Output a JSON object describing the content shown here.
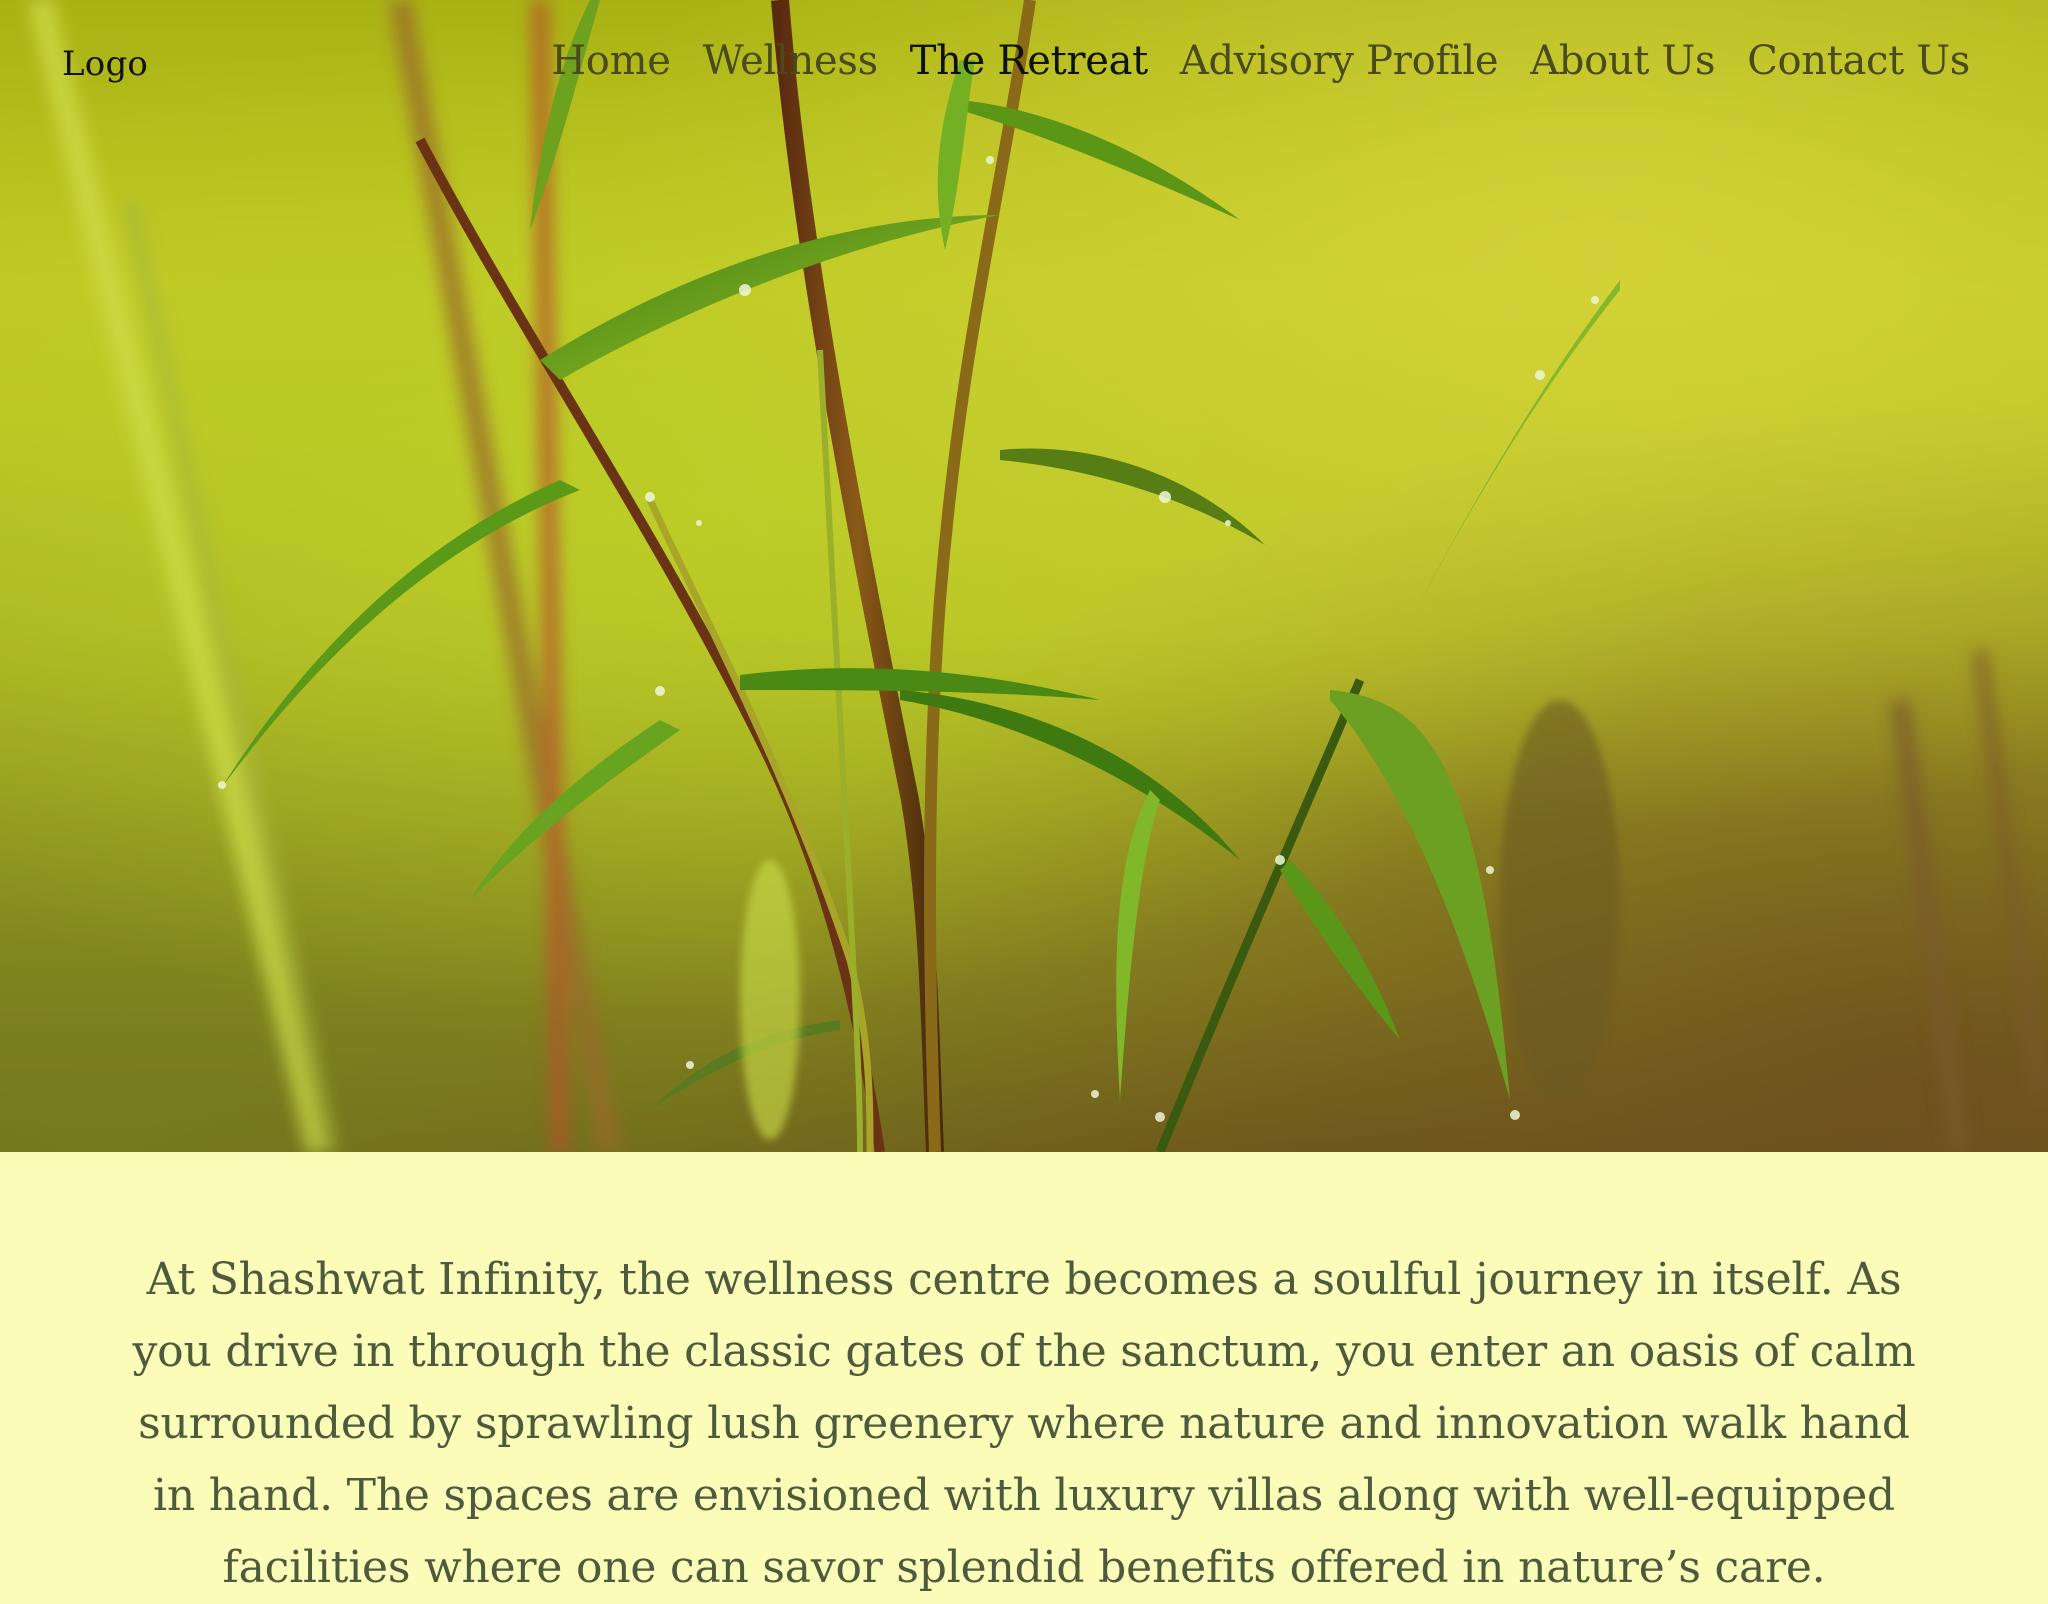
{
  "header": {
    "logo": "Logo",
    "nav": [
      {
        "label": "Home",
        "active": false
      },
      {
        "label": "Wellness",
        "active": false
      },
      {
        "label": "The Retreat",
        "active": true
      },
      {
        "label": "Advisory Profile",
        "active": false
      },
      {
        "label": "About Us",
        "active": false
      },
      {
        "label": "Contact Us",
        "active": false
      }
    ]
  },
  "hero": {
    "image_subject": "bamboo-shoots-with-dew-drops"
  },
  "intro": {
    "text": "At Shashwat Infinity, the wellness centre becomes a soulful journey in itself. As you drive in through the classic gates of the sanctum, you enter an oasis of calm surrounded by sprawling lush greenery where nature and innovation walk hand in hand. The spaces are envisioned with luxury villas along with well-equipped facilities where one can savor splendid benefits offered in nature’s care."
  },
  "colors": {
    "page_background": "#fbfcb7",
    "body_text": "#4e5a3d",
    "nav_text": "#4a4a1c",
    "nav_active": "#101208"
  }
}
